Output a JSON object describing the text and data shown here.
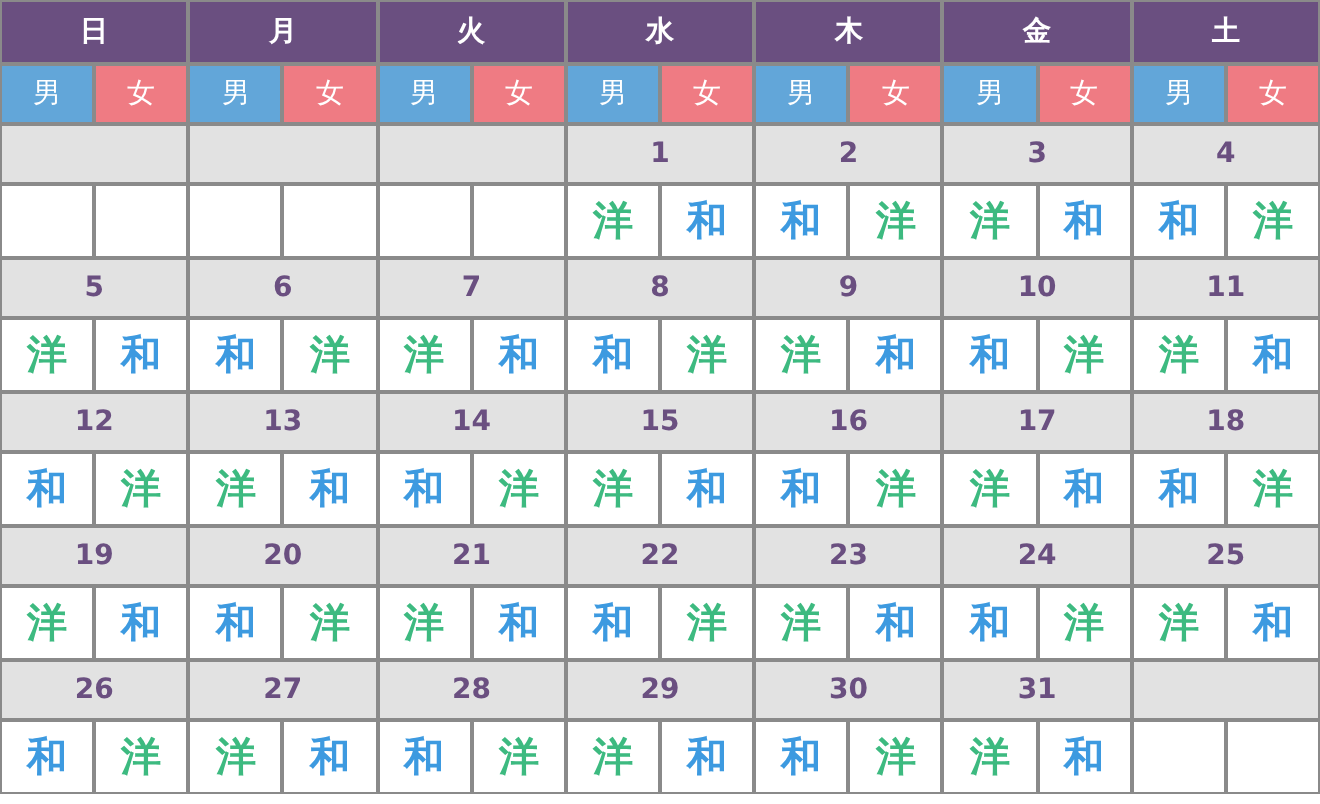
{
  "weekdays": [
    {
      "label": "日",
      "genders": [
        {
          "kind": "male",
          "label": "男"
        },
        {
          "kind": "female",
          "label": "女"
        }
      ]
    },
    {
      "label": "月",
      "genders": [
        {
          "kind": "male",
          "label": "男"
        },
        {
          "kind": "female",
          "label": "女"
        }
      ]
    },
    {
      "label": "火",
      "genders": [
        {
          "kind": "male",
          "label": "男"
        },
        {
          "kind": "female",
          "label": "女"
        }
      ]
    },
    {
      "label": "水",
      "genders": [
        {
          "kind": "male",
          "label": "男"
        },
        {
          "kind": "female",
          "label": "女"
        }
      ]
    },
    {
      "label": "木",
      "genders": [
        {
          "kind": "male",
          "label": "男"
        },
        {
          "kind": "female",
          "label": "女"
        }
      ]
    },
    {
      "label": "金",
      "genders": [
        {
          "kind": "male",
          "label": "男"
        },
        {
          "kind": "female",
          "label": "女"
        }
      ]
    },
    {
      "label": "土",
      "genders": [
        {
          "kind": "male",
          "label": "男"
        },
        {
          "kind": "female",
          "label": "女"
        }
      ]
    }
  ],
  "weeks": [
    [
      {
        "kind": "blank"
      },
      {
        "kind": "blank"
      },
      {
        "kind": "blank"
      },
      {
        "date": "1",
        "meals": [
          {
            "kind": "yo",
            "label": "洋"
          },
          {
            "kind": "wa",
            "label": "和"
          }
        ]
      },
      {
        "date": "2",
        "meals": [
          {
            "kind": "wa",
            "label": "和"
          },
          {
            "kind": "yo",
            "label": "洋"
          }
        ]
      },
      {
        "date": "3",
        "meals": [
          {
            "kind": "yo",
            "label": "洋"
          },
          {
            "kind": "wa",
            "label": "和"
          }
        ]
      },
      {
        "date": "4",
        "meals": [
          {
            "kind": "wa",
            "label": "和"
          },
          {
            "kind": "yo",
            "label": "洋"
          }
        ]
      }
    ],
    [
      {
        "date": "5",
        "meals": [
          {
            "kind": "yo",
            "label": "洋"
          },
          {
            "kind": "wa",
            "label": "和"
          }
        ]
      },
      {
        "date": "6",
        "meals": [
          {
            "kind": "wa",
            "label": "和"
          },
          {
            "kind": "yo",
            "label": "洋"
          }
        ]
      },
      {
        "date": "7",
        "meals": [
          {
            "kind": "yo",
            "label": "洋"
          },
          {
            "kind": "wa",
            "label": "和"
          }
        ]
      },
      {
        "date": "8",
        "meals": [
          {
            "kind": "wa",
            "label": "和"
          },
          {
            "kind": "yo",
            "label": "洋"
          }
        ]
      },
      {
        "date": "9",
        "meals": [
          {
            "kind": "yo",
            "label": "洋"
          },
          {
            "kind": "wa",
            "label": "和"
          }
        ]
      },
      {
        "date": "10",
        "meals": [
          {
            "kind": "wa",
            "label": "和"
          },
          {
            "kind": "yo",
            "label": "洋"
          }
        ]
      },
      {
        "date": "11",
        "meals": [
          {
            "kind": "yo",
            "label": "洋"
          },
          {
            "kind": "wa",
            "label": "和"
          }
        ]
      }
    ],
    [
      {
        "date": "12",
        "meals": [
          {
            "kind": "wa",
            "label": "和"
          },
          {
            "kind": "yo",
            "label": "洋"
          }
        ]
      },
      {
        "date": "13",
        "meals": [
          {
            "kind": "yo",
            "label": "洋"
          },
          {
            "kind": "wa",
            "label": "和"
          }
        ]
      },
      {
        "date": "14",
        "meals": [
          {
            "kind": "wa",
            "label": "和"
          },
          {
            "kind": "yo",
            "label": "洋"
          }
        ]
      },
      {
        "date": "15",
        "meals": [
          {
            "kind": "yo",
            "label": "洋"
          },
          {
            "kind": "wa",
            "label": "和"
          }
        ]
      },
      {
        "date": "16",
        "meals": [
          {
            "kind": "wa",
            "label": "和"
          },
          {
            "kind": "yo",
            "label": "洋"
          }
        ]
      },
      {
        "date": "17",
        "meals": [
          {
            "kind": "yo",
            "label": "洋"
          },
          {
            "kind": "wa",
            "label": "和"
          }
        ]
      },
      {
        "date": "18",
        "meals": [
          {
            "kind": "wa",
            "label": "和"
          },
          {
            "kind": "yo",
            "label": "洋"
          }
        ]
      }
    ],
    [
      {
        "date": "19",
        "meals": [
          {
            "kind": "yo",
            "label": "洋"
          },
          {
            "kind": "wa",
            "label": "和"
          }
        ]
      },
      {
        "date": "20",
        "meals": [
          {
            "kind": "wa",
            "label": "和"
          },
          {
            "kind": "yo",
            "label": "洋"
          }
        ]
      },
      {
        "date": "21",
        "meals": [
          {
            "kind": "yo",
            "label": "洋"
          },
          {
            "kind": "wa",
            "label": "和"
          }
        ]
      },
      {
        "date": "22",
        "meals": [
          {
            "kind": "wa",
            "label": "和"
          },
          {
            "kind": "yo",
            "label": "洋"
          }
        ]
      },
      {
        "date": "23",
        "meals": [
          {
            "kind": "yo",
            "label": "洋"
          },
          {
            "kind": "wa",
            "label": "和"
          }
        ]
      },
      {
        "date": "24",
        "meals": [
          {
            "kind": "wa",
            "label": "和"
          },
          {
            "kind": "yo",
            "label": "洋"
          }
        ]
      },
      {
        "date": "25",
        "meals": [
          {
            "kind": "yo",
            "label": "洋"
          },
          {
            "kind": "wa",
            "label": "和"
          }
        ]
      }
    ],
    [
      {
        "date": "26",
        "meals": [
          {
            "kind": "wa",
            "label": "和"
          },
          {
            "kind": "yo",
            "label": "洋"
          }
        ]
      },
      {
        "date": "27",
        "meals": [
          {
            "kind": "yo",
            "label": "洋"
          },
          {
            "kind": "wa",
            "label": "和"
          }
        ]
      },
      {
        "date": "28",
        "meals": [
          {
            "kind": "wa",
            "label": "和"
          },
          {
            "kind": "yo",
            "label": "洋"
          }
        ]
      },
      {
        "date": "29",
        "meals": [
          {
            "kind": "yo",
            "label": "洋"
          },
          {
            "kind": "wa",
            "label": "和"
          }
        ]
      },
      {
        "date": "30",
        "meals": [
          {
            "kind": "wa",
            "label": "和"
          },
          {
            "kind": "yo",
            "label": "洋"
          }
        ]
      },
      {
        "date": "31",
        "meals": [
          {
            "kind": "yo",
            "label": "洋"
          },
          {
            "kind": "wa",
            "label": "和"
          }
        ]
      },
      {
        "kind": "blank"
      }
    ]
  ]
}
